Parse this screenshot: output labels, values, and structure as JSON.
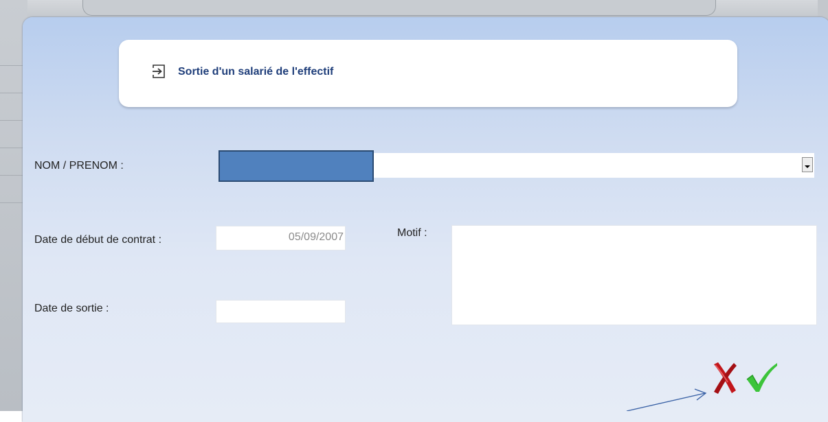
{
  "dialog": {
    "title": "Sortie d'un salarié de l'effectif",
    "title_icon": "sign-out-icon"
  },
  "form": {
    "name_label": "NOM / PRENOM :",
    "name_value": "",
    "contract_start_label": "Date de début de contrat :",
    "contract_start_value": "05/09/2007",
    "exit_date_label": "Date de sortie :",
    "exit_date_value": "",
    "reason_label": "Motif :",
    "reason_value": ""
  },
  "actions": {
    "cancel_icon": "red-x-icon",
    "confirm_icon": "green-check-icon"
  },
  "colors": {
    "title_text": "#1f3e7a",
    "cancel": "#c2161b",
    "confirm": "#3cc43a",
    "redaction": "#5081be"
  }
}
